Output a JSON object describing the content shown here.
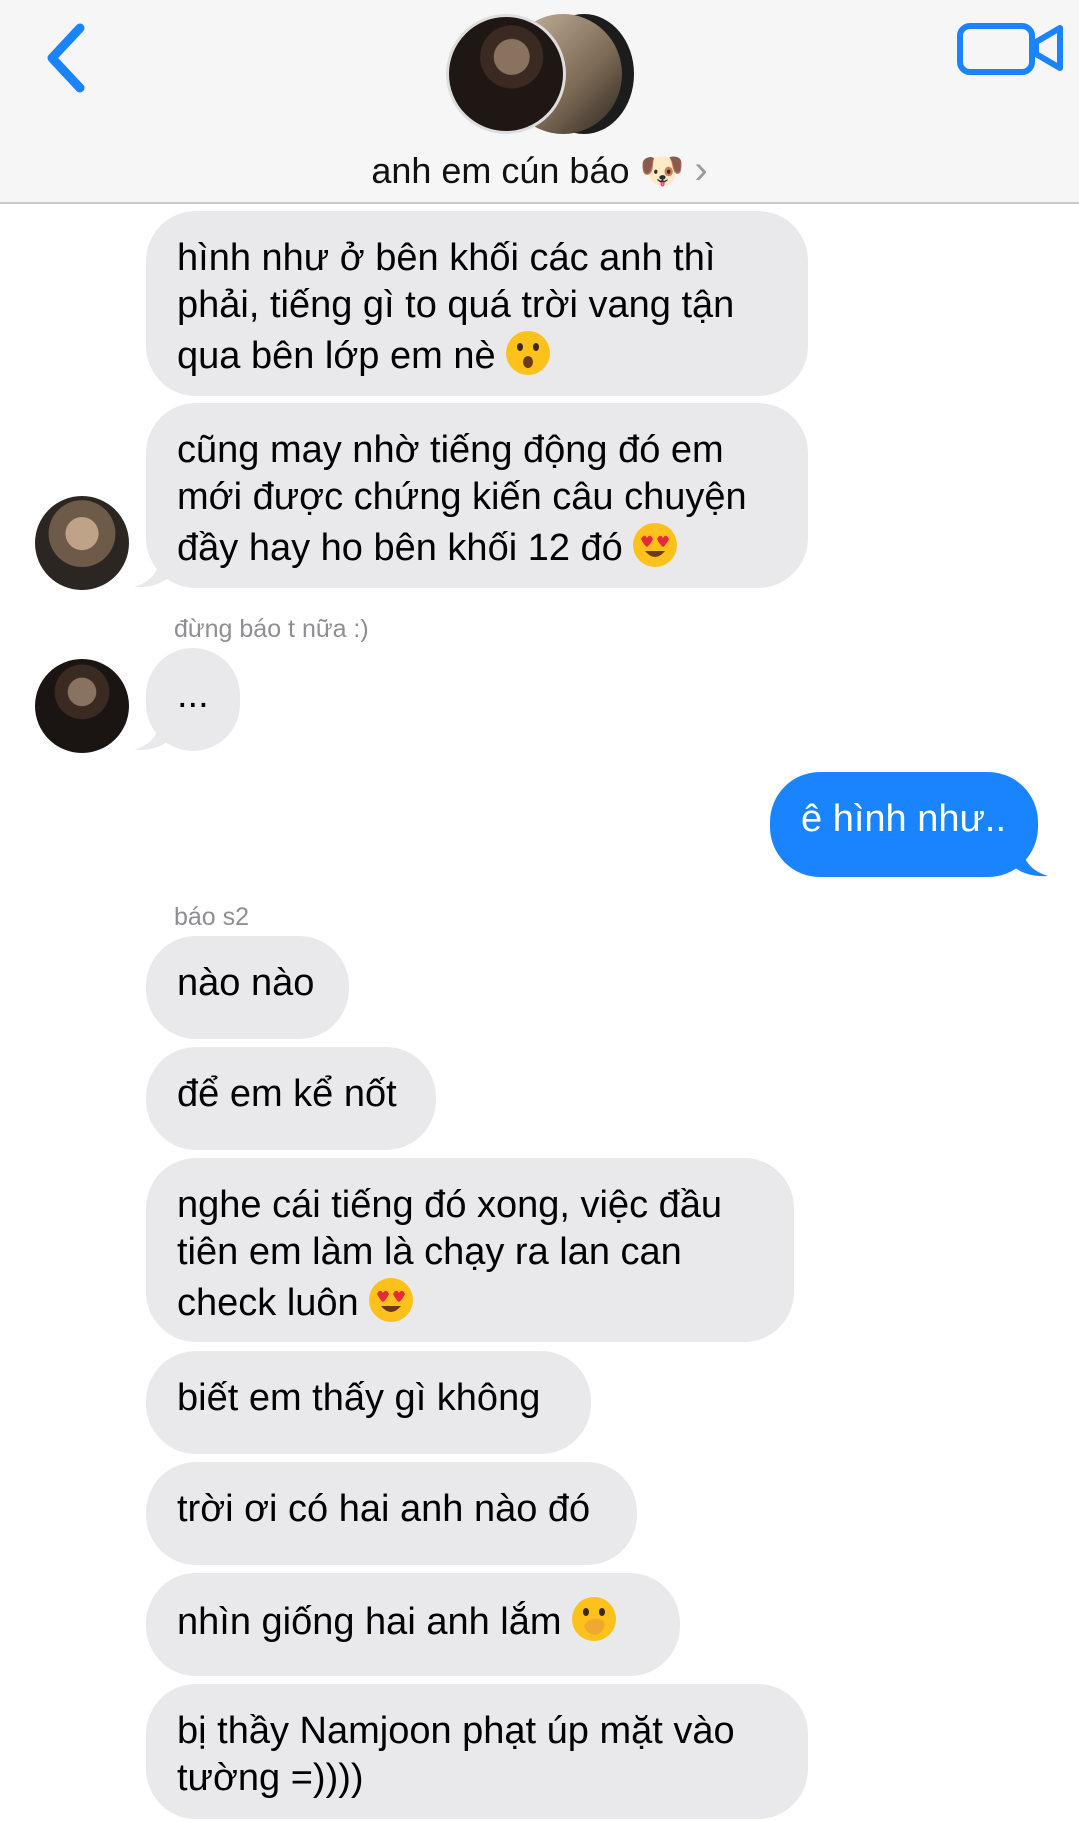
{
  "header": {
    "group_name": "anh em cún báo 🐶",
    "chevron": "›",
    "back_icon": "chevron-left-icon",
    "video_icon": "video-camera-icon",
    "accent": "#1a84ff"
  },
  "messages": {
    "m1": {
      "lines": [
        "hình như ở bên khối các anh thì",
        "phải, tiếng gì to quá trời vang tận",
        "qua bên lớp em nè"
      ],
      "emoji": "astonished-face-icon"
    },
    "m2": {
      "lines": [
        "cũng may nhờ tiếng động đó em",
        "mới được chứng kiến câu chuyện",
        "đầy hay ho bên khối 12 đó"
      ],
      "emoji": "heart-eyes-icon"
    },
    "sender2": "đừng báo t nữa :)",
    "m3": {
      "text": "..."
    },
    "m4": {
      "text": "ê hình như.."
    },
    "sender3": "báo s2",
    "m5": {
      "text": "nào nào"
    },
    "m6": {
      "text": "để em kể nốt"
    },
    "m7": {
      "lines": [
        "nghe cái tiếng đó xong, việc đầu",
        "tiên em làm là chạy ra lan can",
        "check luôn"
      ],
      "emoji": "heart-eyes-icon"
    },
    "m8": {
      "text": "biết em thấy gì không"
    },
    "m9": {
      "text": "trời ơi có hai anh nào đó"
    },
    "m10": {
      "text": "nhìn giống hai anh lắm",
      "emoji": "face-with-hand-over-mouth-icon"
    },
    "m11": {
      "lines": [
        "bị thầy Namjoon phạt úp mặt vào",
        "tường =))))"
      ]
    }
  }
}
